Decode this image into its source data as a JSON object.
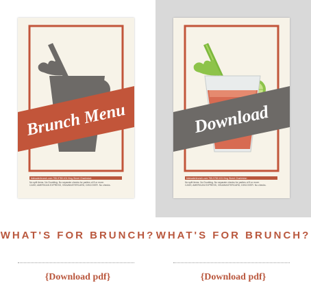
{
  "cards": [
    {
      "poster_banner": "Brunch Menu",
      "poster_footer_line": "tidewaterbrunch.com  755-9780  401 King Street Charleston",
      "poster_footer_text_1": "No split items. No Doubling. No separate checks for parties of 8 or more.",
      "poster_footer_text_2": "CASH, AMERICAN EXPRESS, VISA/MASTERCARD, DISCOVER. No checks.",
      "title": "WHAT'S FOR BRUNCH?",
      "link_label": "{Download pdf}"
    },
    {
      "poster_banner": "Download",
      "poster_footer_line": "tidewaterbrunch.com  755-9780  401 King Street Charleston",
      "poster_footer_text_1": "No split items. No Doubling. No separate checks for parties of 8 or more.",
      "poster_footer_text_2": "CASH, AMERICAN EXPRESS, VISA/MASTERCARD, DISCOVER. No checks.",
      "title": "WHAT'S FOR BRUNCH?",
      "link_label": "{Download pdf}"
    }
  ],
  "colors": {
    "accent": "#b9573d",
    "banner_red": "#c2553a",
    "banner_gray": "#6d6a67",
    "poster_bg": "#f7f3e8"
  }
}
